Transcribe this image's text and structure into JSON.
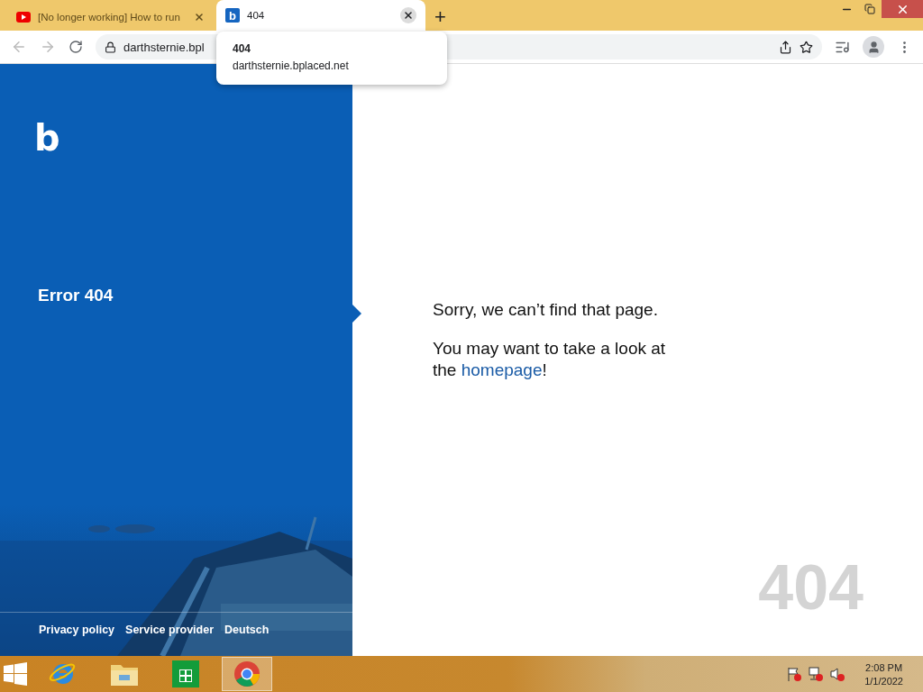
{
  "browser": {
    "tabs": [
      {
        "title": "[No longer working] How to run",
        "selected": false,
        "kind": "video"
      },
      {
        "title": "404",
        "selected": true,
        "kind": "letter",
        "favicon_letter": "b"
      }
    ],
    "new_tab": "+",
    "address": "darthsternie.bpl",
    "tooltip": {
      "title": "404",
      "url": "darthsternie.bplaced.net"
    }
  },
  "page": {
    "logo": "b",
    "heading": "Error 404",
    "message": "Sorry, we can’t find that page.",
    "suggestion": "You may want to take a look at the",
    "link": "homepage",
    "suffix": "!",
    "links": [
      "Privacy policy",
      "Service provider",
      "Deutsch"
    ],
    "big_code": "404"
  },
  "taskbar": {
    "apps": [
      {
        "kind": "ie",
        "selected": false
      },
      {
        "kind": "folder",
        "selected": false
      },
      {
        "kind": "store",
        "selected": false
      },
      {
        "kind": "chrome",
        "selected": true
      }
    ],
    "time": "2:08 PM",
    "date": "1/1/2022"
  }
}
